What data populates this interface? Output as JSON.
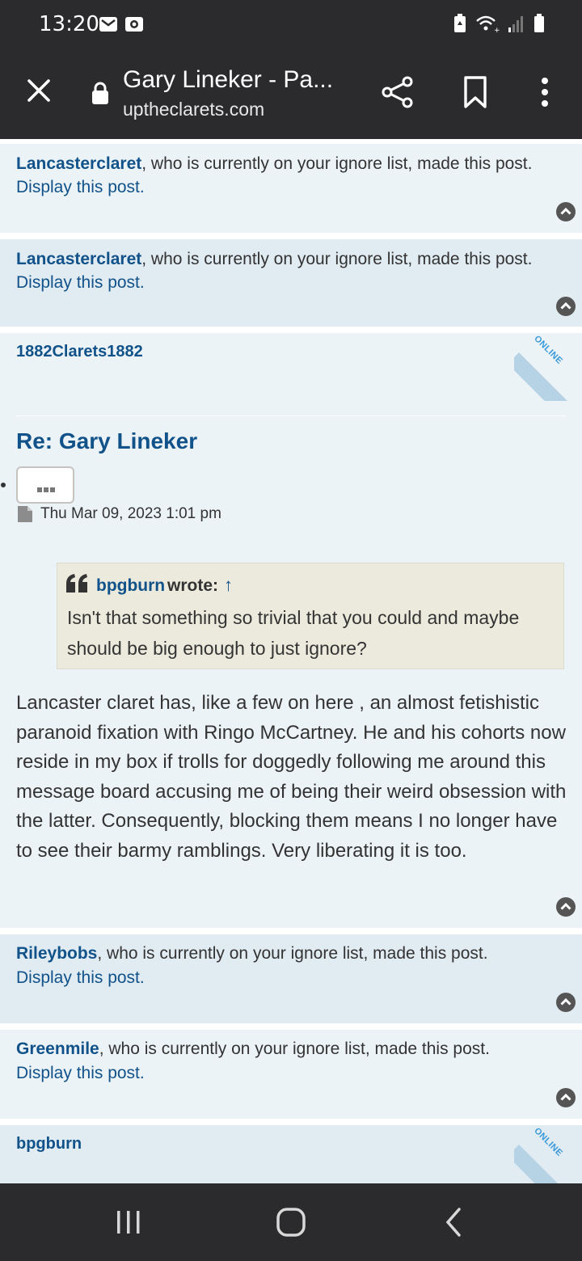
{
  "status_bar": {
    "time": "13:20",
    "left_icons": [
      "mail-icon",
      "camera-icon"
    ],
    "right_icons": [
      "battery-saver-icon",
      "wifi-icon",
      "signal-icon",
      "battery-icon"
    ]
  },
  "app_bar": {
    "title": "Gary Lineker - Pa...",
    "domain": "uptheclarets.com",
    "icons": [
      "close-icon",
      "lock-icon",
      "share-icon",
      "bookmark-icon",
      "more-vert-icon"
    ]
  },
  "ignored_posts": [
    {
      "username": "Lancasterclaret",
      "message": ", who is currently on your ignore list, made this post.",
      "link": "Display this post."
    },
    {
      "username": "Lancasterclaret",
      "message": ", who is currently on your ignore list, made this post.",
      "link": "Display this post."
    },
    {
      "username": "Rileybobs",
      "message": ", who is currently on your ignore list, made this post.",
      "link": "Display this post."
    },
    {
      "username": "Greenmile",
      "message": ", who is currently on your ignore list, made this post.",
      "link": "Display this post."
    }
  ],
  "main_post": {
    "author": "1882Clarets1882",
    "online_badge": "ONLINE",
    "title": "Re: Gary Lineker",
    "menu_label": "•••",
    "date": "Thu Mar 09, 2023 1:01 pm",
    "quote": {
      "author": "bpgburn",
      "wrote": "wrote:",
      "arrow": "↑",
      "text": "Isn't that something so trivial that you could and maybe should be big enough to just ignore?"
    },
    "body": "Lancaster claret has, like a few on here , an almost fetishistic paranoid fixation with Ringo McCartney. He and his cohorts now reside in my box if trolls for doggedly following me around this message board accusing me of being their weird obsession with the latter. Consequently, blocking them means I no longer have to see their barmy ramblings. Very liberating it is too."
  },
  "next_post": {
    "author": "bpgburn",
    "online_badge": "ONLINE"
  },
  "colors": {
    "bar": "#2b2b2d",
    "link": "#105289",
    "post_bg_light": "#ecf3f7",
    "post_bg_alt": "#e1ebf2",
    "quote_bg": "#ebeadd"
  }
}
